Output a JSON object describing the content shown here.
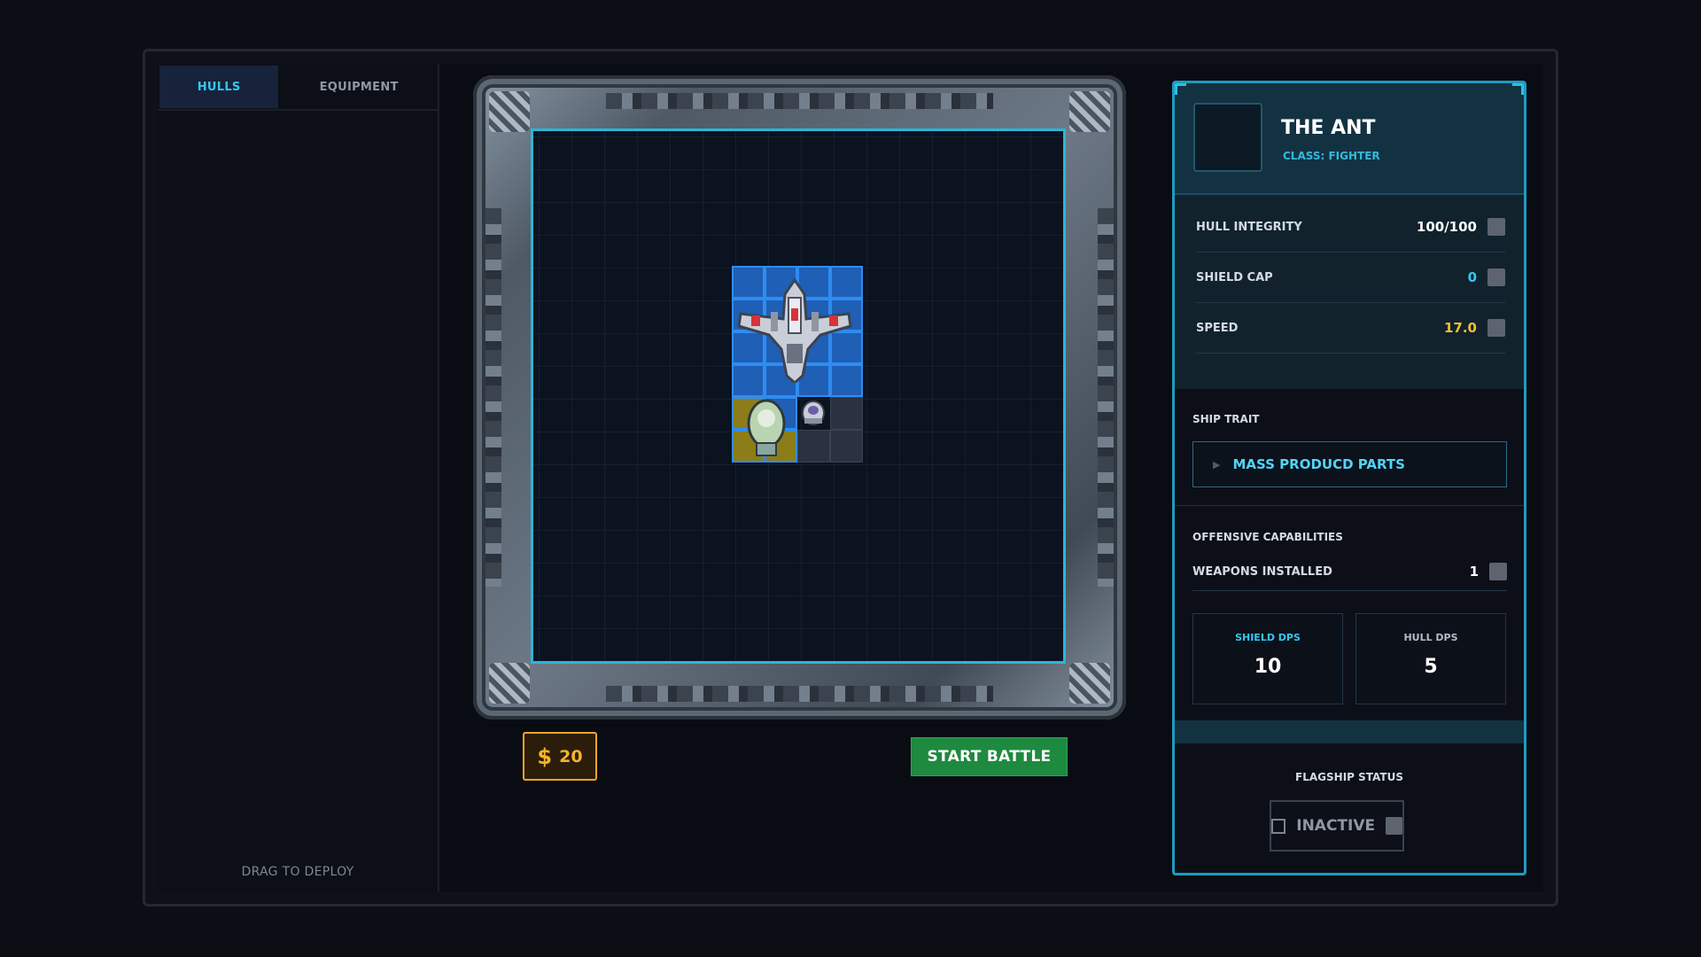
{
  "tabs": {
    "hulls": "HULLS",
    "equipment": "EQUIPMENT"
  },
  "left_panel": {
    "hint": "DRAG TO DEPLOY"
  },
  "board": {
    "blue_cells": [
      [
        0,
        0
      ],
      [
        1,
        0
      ],
      [
        2,
        0
      ],
      [
        3,
        0
      ],
      [
        0,
        1
      ],
      [
        1,
        1
      ],
      [
        2,
        1
      ],
      [
        3,
        1
      ],
      [
        0,
        2
      ],
      [
        1,
        2
      ],
      [
        2,
        2
      ],
      [
        3,
        2
      ],
      [
        0,
        3
      ],
      [
        1,
        3
      ],
      [
        2,
        3
      ],
      [
        3,
        3
      ],
      [
        1,
        4
      ]
    ],
    "grey_cells": [
      [
        3,
        4
      ],
      [
        2,
        5
      ],
      [
        3,
        5
      ]
    ],
    "gold_cells": [
      [
        0,
        4
      ],
      [
        0,
        5
      ],
      [
        1,
        5
      ]
    ]
  },
  "money": {
    "symbol": "$",
    "amount": "20"
  },
  "actions": {
    "start_battle": "START BATTLE"
  },
  "ship": {
    "name": "THE ANT",
    "class": "CLASS: FIGHTER",
    "stats": [
      {
        "label": "HULL INTEGRITY",
        "value": "100/100",
        "color": "#ffffff"
      },
      {
        "label": "SHIELD CAP",
        "value": "0",
        "color": "#34c8f0"
      },
      {
        "label": "SPEED",
        "value": "17.0",
        "color": "#f3c02f"
      }
    ],
    "trait_heading": "SHIP TRAIT",
    "trait": "MASS PRODUCD PARTS",
    "offense_heading": "OFFENSIVE CAPABILITIES",
    "weapons_label": "WEAPONS INSTALLED",
    "weapons_value": "1",
    "shield_dps_label": "SHIELD DPS",
    "shield_dps_value": "10",
    "hull_dps_label": "HULL DPS",
    "hull_dps_value": "5",
    "flagship_heading": "FLAGSHIP STATUS",
    "flagship_state": "INACTIVE"
  }
}
